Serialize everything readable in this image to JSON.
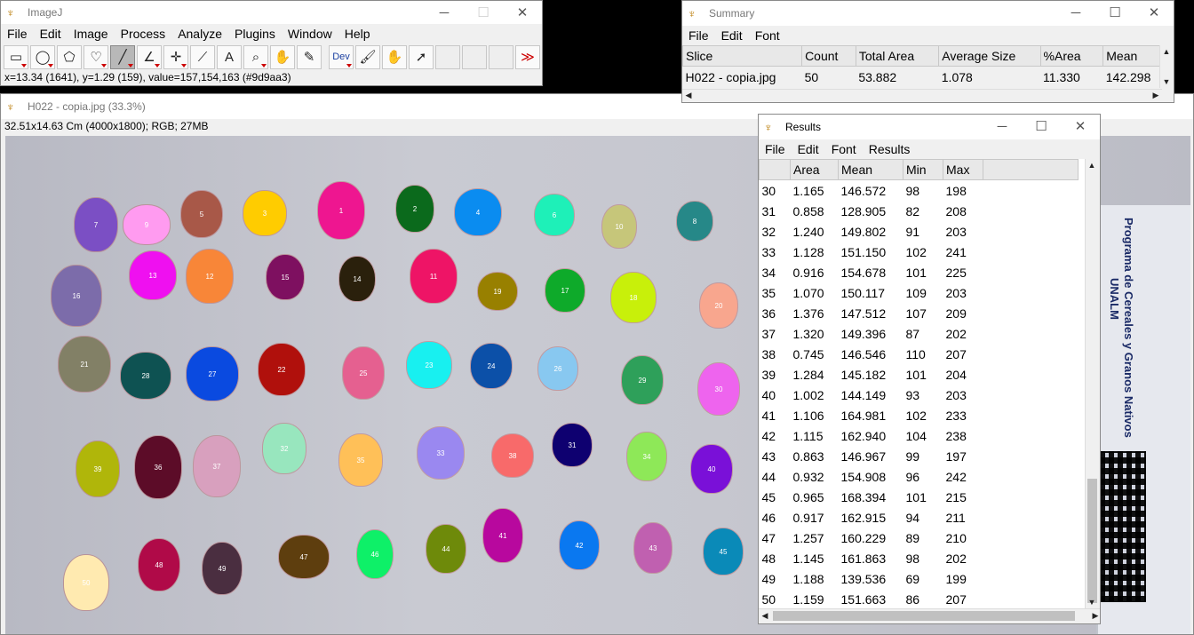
{
  "imagej": {
    "title": "ImageJ",
    "menus": [
      "File",
      "Edit",
      "Image",
      "Process",
      "Analyze",
      "Plugins",
      "Window",
      "Help"
    ],
    "tools": [
      {
        "icon": "rectangle-tool-icon",
        "glyph": "▭"
      },
      {
        "icon": "oval-tool-icon",
        "glyph": "◯"
      },
      {
        "icon": "polygon-tool-icon",
        "glyph": "⬠"
      },
      {
        "icon": "freehand-tool-icon",
        "glyph": "♡"
      },
      {
        "icon": "line-tool-icon",
        "glyph": "╱"
      },
      {
        "icon": "angle-tool-icon",
        "glyph": "∠"
      },
      {
        "icon": "multipoint-tool-icon",
        "glyph": "✛"
      },
      {
        "icon": "wand-tool-icon",
        "glyph": "⟋"
      },
      {
        "icon": "text-tool-icon",
        "glyph": "A"
      },
      {
        "icon": "magnifier-tool-icon",
        "glyph": "⌕"
      },
      {
        "icon": "hand-tool-icon",
        "glyph": "✋"
      },
      {
        "icon": "color-picker-tool-icon",
        "glyph": "✎"
      },
      {
        "icon": "dev-menu-icon",
        "glyph": "Dev"
      },
      {
        "icon": "brush-tool-icon",
        "glyph": "🖌"
      },
      {
        "icon": "flood-fill-tool-icon",
        "glyph": "✋"
      },
      {
        "icon": "arrow-tool-icon",
        "glyph": "➚"
      }
    ],
    "status": "x=13.34 (1641), y=1.29 (159), value=157,154,163 (#9d9aa3)",
    "more_glyph": "≫"
  },
  "image_window": {
    "title": "H022 - copia.jpg (33.3%)",
    "info": "32.51x14.63 Cm (4000x1800); RGB; 27MB",
    "side_label_1": "Programa de Cereales y Granos Nativos",
    "side_label_2": "UNALM"
  },
  "summary": {
    "title": "Summary",
    "menus": [
      "File",
      "Edit",
      "Font"
    ],
    "headers": [
      "Slice",
      "Count",
      "Total Area",
      "Average Size",
      "%Area",
      "Mean"
    ],
    "row": [
      "H022 - copia.jpg",
      "50",
      "53.882",
      "1.078",
      "11.330",
      "142.298"
    ]
  },
  "results": {
    "title": "Results",
    "menus": [
      "File",
      "Edit",
      "Font",
      "Results"
    ],
    "headers": [
      "",
      "Area",
      "Mean",
      "Min",
      "Max"
    ],
    "rows": [
      [
        "30",
        "1.165",
        "146.572",
        "98",
        "198"
      ],
      [
        "31",
        "0.858",
        "128.905",
        "82",
        "208"
      ],
      [
        "32",
        "1.240",
        "149.802",
        "91",
        "203"
      ],
      [
        "33",
        "1.128",
        "151.150",
        "102",
        "241"
      ],
      [
        "34",
        "0.916",
        "154.678",
        "101",
        "225"
      ],
      [
        "35",
        "1.070",
        "150.117",
        "109",
        "203"
      ],
      [
        "36",
        "1.376",
        "147.512",
        "107",
        "209"
      ],
      [
        "37",
        "1.320",
        "149.396",
        "87",
        "202"
      ],
      [
        "38",
        "0.745",
        "146.546",
        "110",
        "207"
      ],
      [
        "39",
        "1.284",
        "145.182",
        "101",
        "204"
      ],
      [
        "40",
        "1.002",
        "144.149",
        "93",
        "203"
      ],
      [
        "41",
        "1.106",
        "164.981",
        "102",
        "233"
      ],
      [
        "42",
        "1.115",
        "162.940",
        "104",
        "238"
      ],
      [
        "43",
        "0.863",
        "146.967",
        "99",
        "197"
      ],
      [
        "44",
        "0.932",
        "154.908",
        "96",
        "242"
      ],
      [
        "45",
        "0.965",
        "168.394",
        "101",
        "215"
      ],
      [
        "46",
        "0.917",
        "162.915",
        "94",
        "211"
      ],
      [
        "47",
        "1.257",
        "160.229",
        "89",
        "210"
      ],
      [
        "48",
        "1.145",
        "161.863",
        "98",
        "202"
      ],
      [
        "49",
        "1.188",
        "139.536",
        "69",
        "199"
      ],
      [
        "50",
        "1.159",
        "151.663",
        "86",
        "207"
      ]
    ]
  },
  "particles": [
    {
      "n": "7",
      "c": "#7b4fc4"
    },
    {
      "n": "9",
      "c": "#ff9bf0"
    },
    {
      "n": "5",
      "c": "#a85848"
    },
    {
      "n": "3",
      "c": "#ffcc00"
    },
    {
      "n": "1",
      "c": "#ee1690"
    },
    {
      "n": "2",
      "c": "#0b6a1c"
    },
    {
      "n": "4",
      "c": "#0a8cf0"
    },
    {
      "n": "6",
      "c": "#1ef0b8"
    },
    {
      "n": "10",
      "c": "#c6c67a"
    },
    {
      "n": "8",
      "c": "#268888"
    },
    {
      "n": "16",
      "c": "#7c6caa"
    },
    {
      "n": "13",
      "c": "#ef10f0"
    },
    {
      "n": "12",
      "c": "#f88638"
    },
    {
      "n": "15",
      "c": "#7e1060"
    },
    {
      "n": "14",
      "c": "#2a200c"
    },
    {
      "n": "11",
      "c": "#ee1466"
    },
    {
      "n": "19",
      "c": "#988000"
    },
    {
      "n": "17",
      "c": "#0eaa2a"
    },
    {
      "n": "18",
      "c": "#c8f00a"
    },
    {
      "n": "20",
      "c": "#f8a68e"
    },
    {
      "n": "21",
      "c": "#828066"
    },
    {
      "n": "28",
      "c": "#0e5252"
    },
    {
      "n": "27",
      "c": "#0a4ae0"
    },
    {
      "n": "22",
      "c": "#b0100c"
    },
    {
      "n": "25",
      "c": "#e56090"
    },
    {
      "n": "23",
      "c": "#18f0f0"
    },
    {
      "n": "24",
      "c": "#0c50a8"
    },
    {
      "n": "26",
      "c": "#88c8f0"
    },
    {
      "n": "29",
      "c": "#2ea05a"
    },
    {
      "n": "30",
      "c": "#ee64ee"
    },
    {
      "n": "39",
      "c": "#b0b60a"
    },
    {
      "n": "36",
      "c": "#5c0c28"
    },
    {
      "n": "37",
      "c": "#d8a0be"
    },
    {
      "n": "32",
      "c": "#98e6be"
    },
    {
      "n": "35",
      "c": "#ffc058"
    },
    {
      "n": "33",
      "c": "#9a88f0"
    },
    {
      "n": "38",
      "c": "#f86a6a"
    },
    {
      "n": "31",
      "c": "#0e0070"
    },
    {
      "n": "34",
      "c": "#8ee858"
    },
    {
      "n": "40",
      "c": "#7a10d8"
    },
    {
      "n": "50",
      "c": "#ffeab0"
    },
    {
      "n": "48",
      "c": "#b00a48"
    },
    {
      "n": "49",
      "c": "#4a2e40"
    },
    {
      "n": "47",
      "c": "#5e3e0e"
    },
    {
      "n": "46",
      "c": "#0ef068"
    },
    {
      "n": "44",
      "c": "#6e8a0a"
    },
    {
      "n": "41",
      "c": "#b8089e"
    },
    {
      "n": "42",
      "c": "#0a78f0"
    },
    {
      "n": "43",
      "c": "#c060b0"
    },
    {
      "n": "45",
      "c": "#0a8ab8"
    }
  ]
}
